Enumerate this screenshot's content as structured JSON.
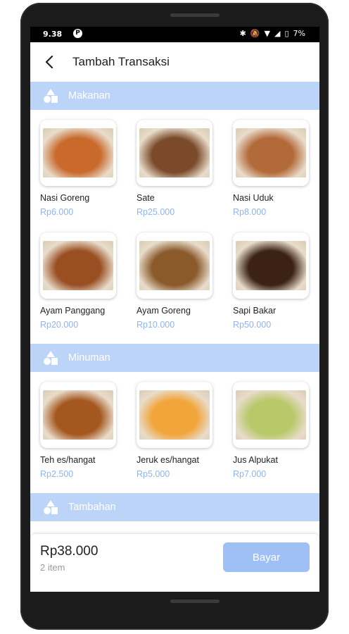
{
  "status": {
    "time": "9.38",
    "battery": "7%"
  },
  "appbar": {
    "title": "Tambah Transaksi"
  },
  "sections": [
    {
      "label": "Makanan",
      "items": [
        {
          "name": "Nasi Goreng",
          "price": "Rp6.000",
          "color": "#c9692c"
        },
        {
          "name": "Sate",
          "price": "Rp25.000",
          "color": "#7a4a2a"
        },
        {
          "name": "Nasi Uduk",
          "price": "Rp8.000",
          "color": "#b36a3a"
        },
        {
          "name": "Ayam Panggang",
          "price": "Rp20.000",
          "color": "#9a4f22"
        },
        {
          "name": "Ayam Goreng",
          "price": "Rp10.000",
          "color": "#8a5a2a"
        },
        {
          "name": "Sapi Bakar",
          "price": "Rp50.000",
          "color": "#3b2215"
        }
      ]
    },
    {
      "label": "Minuman",
      "items": [
        {
          "name": "Teh es/hangat",
          "price": "Rp2.500",
          "color": "#a4571f"
        },
        {
          "name": "Jeruk es/hangat",
          "price": "Rp5.000",
          "color": "#f2a53a"
        },
        {
          "name": "Jus Alpukat",
          "price": "Rp7.000",
          "color": "#b9c96a"
        }
      ]
    },
    {
      "label": "Tambahan",
      "items": []
    }
  ],
  "bottom": {
    "total": "Rp38.000",
    "count": "2 item",
    "pay_label": "Bayar"
  },
  "colors": {
    "accent": "#8fb4f0",
    "header_bg": "#bcd4f7",
    "button_bg": "#9ec0f5"
  }
}
